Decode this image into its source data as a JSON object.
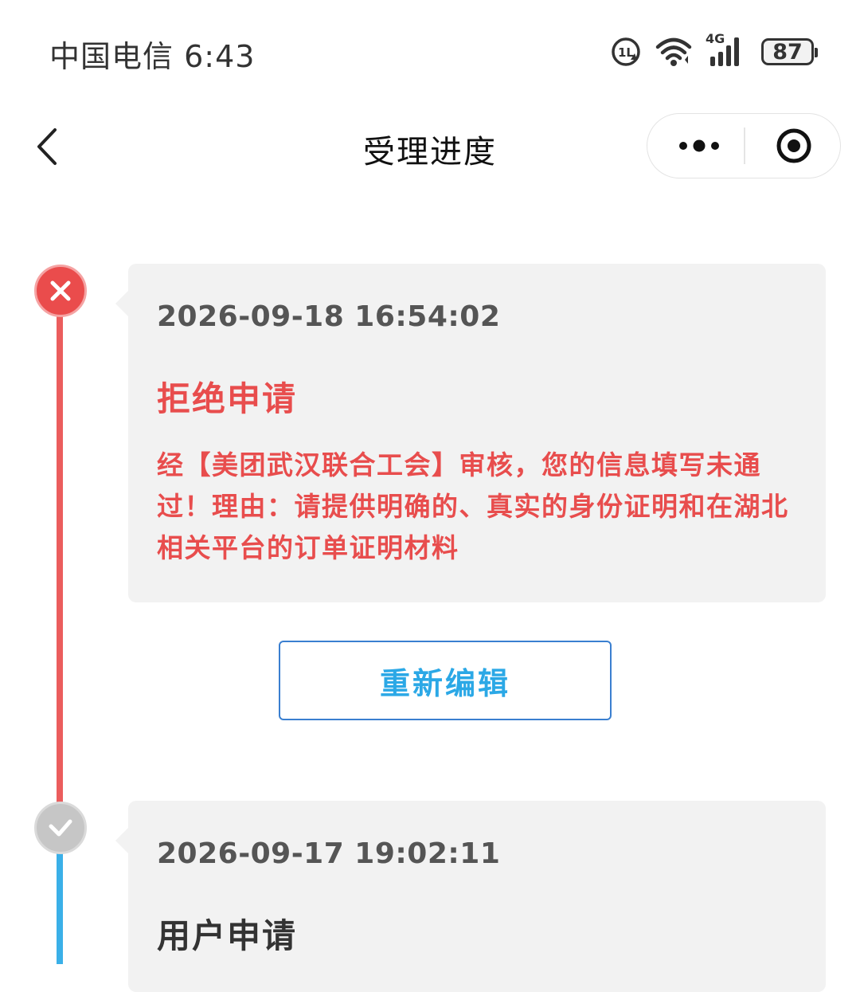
{
  "status_bar": {
    "carrier": "中国电信",
    "time": "6:43",
    "network": "4G",
    "battery": "87",
    "icons": [
      "hd-call-icon",
      "wifi-icon",
      "signal-icon",
      "battery-icon"
    ]
  },
  "nav": {
    "title": "受理进度",
    "back_icon": "chevron-left-icon",
    "more_icon": "more-dots-icon",
    "close_icon": "target-circle-icon"
  },
  "timeline": [
    {
      "time": "2026-09-18 16:54:02",
      "status": "拒绝申请",
      "description": "经【美团武汉联合工会】审核，您的信息填写未通过！理由：请提供明确的、真实的身份证明和在湖北相关平台的订单证明材料",
      "icon": "close-x-icon",
      "color": "#e84d4d"
    },
    {
      "time": "2026-09-17 19:02:11",
      "status": "用户申请",
      "icon": "check-icon",
      "color": "#333333"
    }
  ],
  "actions": {
    "reedit_label": "重新编辑"
  },
  "colors": {
    "reject": "#e84d4d",
    "accent_blue": "#2ba8e6",
    "card_bg": "#f2f2f2"
  }
}
